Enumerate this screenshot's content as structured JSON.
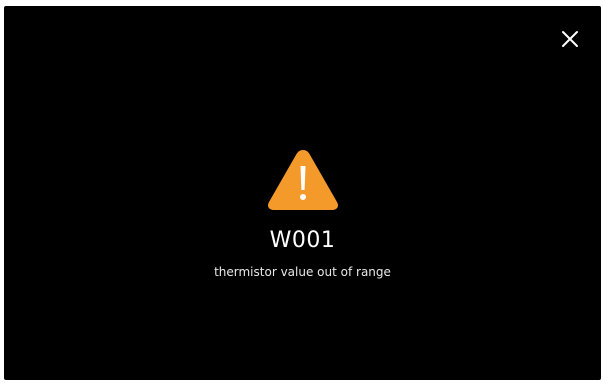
{
  "dialog": {
    "close_icon": "close-icon",
    "warning_icon": "warning-triangle-icon",
    "code": "W001",
    "message": "thermistor value out of range"
  },
  "colors": {
    "background": "#000000",
    "warning": "#f39a2b",
    "text": "#ffffff"
  }
}
